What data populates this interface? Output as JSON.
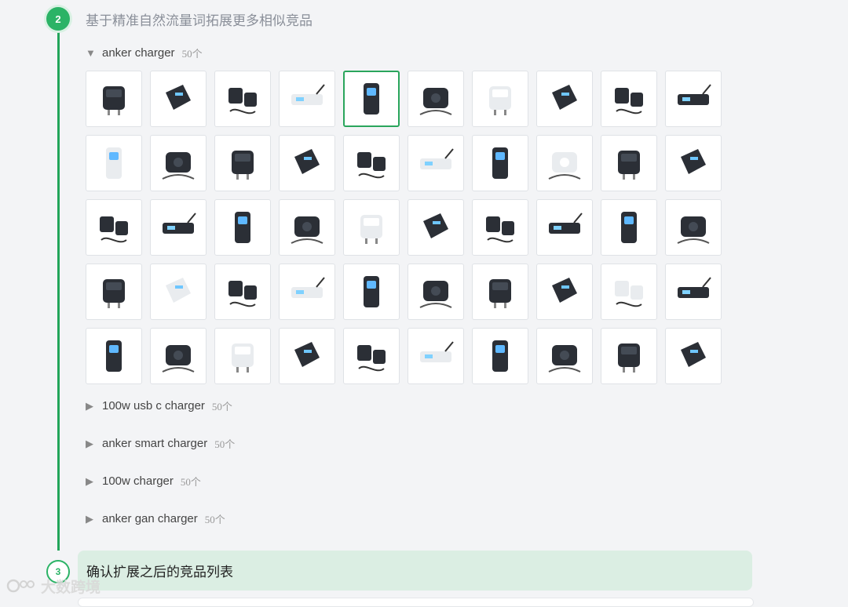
{
  "step2": {
    "number": "2",
    "title": "基于精准自然流量词拓展更多相似竞品"
  },
  "groups": [
    {
      "keyword": "anker charger",
      "count": "50个",
      "expanded": true
    },
    {
      "keyword": "100w usb c charger",
      "count": "50个",
      "expanded": false
    },
    {
      "keyword": "anker smart charger",
      "count": "50个",
      "expanded": false
    },
    {
      "keyword": "100w charger",
      "count": "50个",
      "expanded": false
    },
    {
      "keyword": "anker gan charger",
      "count": "50个",
      "expanded": false
    }
  ],
  "products": [
    "cube-charger-dark-icon",
    "wall-charger-gray-icon",
    "charger-kit-with-cables-icon",
    "compact-charger-black-icon",
    "charger-with-cable-icon",
    "display-charger-icon",
    "charger-cable-bundle-icon",
    "dual-charger-pack-icon",
    "charger-cable-gray-icon",
    "cube-charger-silver-icon",
    "display-charger-white-icon",
    "charging-station-icon",
    "flat-wall-charger-icon",
    "power-strip-icon",
    "charger-pair-cables-icon",
    "mini-charger-dark-icon",
    "mini-charger-white-icon",
    "white-charger-cable-icon",
    "cube-charger-black-icon",
    "mini-charger-pale-icon",
    "desktop-hub-icon",
    "desk-charger-display-icon",
    "power-bank-lanyard-icon",
    "slim-power-bank-icon",
    "wall-charger-black-icon",
    "charger-brick-cable-icon",
    "gan-charger-cable-icon",
    "braided-cables-icon",
    "white-cube-charger-icon",
    "magnetic-battery-icon",
    "power-bank-phone-icon",
    "display-charger-white-2-icon",
    "wireless-stand-icon",
    "white-charger-set-icon",
    "power-bank-large-icon",
    "smart-charger-display-icon",
    "3in1-wireless-station-icon",
    "nano-charger-black-icon",
    "cube-dock-icon",
    "tall-power-bank-icon",
    "magsafe-battery-icon",
    "charger-with-cables-icon",
    "blue-white-charger-icon",
    "desk-power-station-icon",
    "charger-multi-cable-icon",
    "mint-magnetic-battery-icon",
    "wireless-stand-white-icon",
    "dual-charger-black-icon",
    "charger-usb-cable-icon",
    "foldable-station-icon"
  ],
  "selected_index": 4,
  "step3": {
    "number": "3",
    "title": "确认扩展之后的竞品列表"
  },
  "watermark": "大数跨境",
  "accent_color": "#22a55a"
}
